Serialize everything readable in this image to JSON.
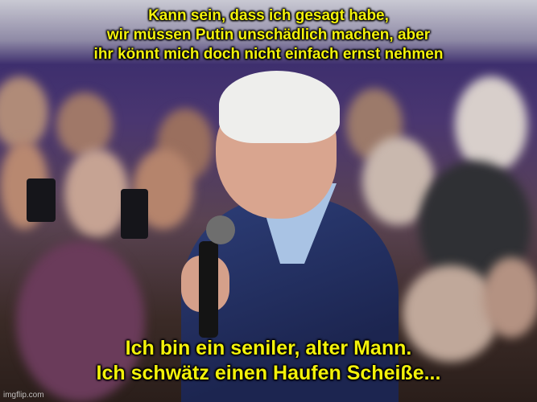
{
  "meme": {
    "top_text": [
      "Kann sein, dass ich gesagt habe,",
      "wir müssen Putin unschädlich machen, aber",
      "ihr könnt mich doch nicht einfach ernst nehmen"
    ],
    "bottom_text": [
      "Ich bin ein seniler, alter Mann.",
      "Ich schwätz einen Haufen Scheiße..."
    ],
    "watermark": "imgflip.com",
    "caption_color": "#f3f20a"
  }
}
